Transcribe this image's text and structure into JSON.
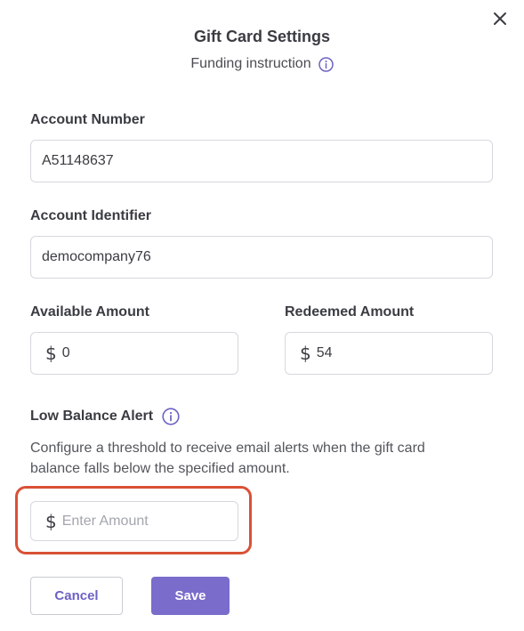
{
  "dialog": {
    "title": "Gift Card Settings",
    "subtitle": "Funding instruction",
    "close_icon": "close-icon",
    "info_icon": "info-icon"
  },
  "fields": {
    "account_number": {
      "label": "Account Number",
      "value": "A51148637"
    },
    "account_identifier": {
      "label": "Account Identifier",
      "value": "democompany76"
    },
    "available_amount": {
      "label": "Available Amount",
      "currency": "$",
      "value": "0"
    },
    "redeemed_amount": {
      "label": "Redeemed Amount",
      "currency": "$",
      "value": "54"
    }
  },
  "low_balance": {
    "label": "Low Balance Alert",
    "description": "Configure a threshold to receive email alerts when the gift card balance falls below the specified amount.",
    "currency": "$",
    "placeholder": "Enter Amount",
    "highlight_color": "#d95135"
  },
  "actions": {
    "cancel_label": "Cancel",
    "save_label": "Save",
    "accent_color": "#7a6ccb"
  }
}
